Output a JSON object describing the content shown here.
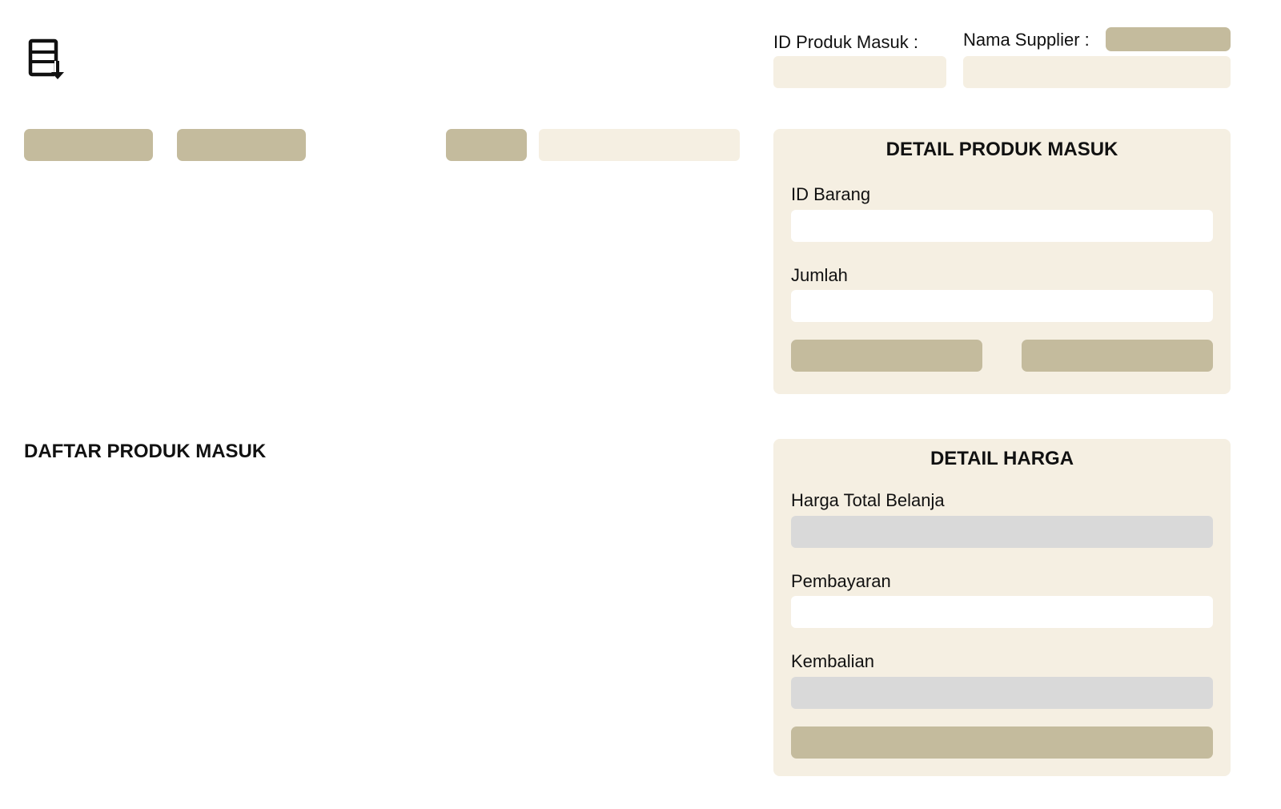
{
  "header": {
    "logo_icon": "document-download-icon",
    "id_produk_masuk_label": "ID Produk Masuk :",
    "id_produk_masuk_value": "",
    "nama_supplier_label": "Nama Supplier :",
    "nama_supplier_value": ""
  },
  "toolbar": {
    "button_1_label": "",
    "button_2_label": "",
    "search_button_label": "",
    "search_value": ""
  },
  "detail_produk_masuk": {
    "title": "DETAIL PRODUK MASUK",
    "id_barang_label": "ID Barang",
    "id_barang_value": "",
    "jumlah_label": "Jumlah",
    "jumlah_value": "",
    "left_button_label": "",
    "right_button_label": ""
  },
  "daftar_produk_masuk": {
    "title": "DAFTAR PRODUK MASUK"
  },
  "detail_harga": {
    "title": "DETAIL HARGA",
    "harga_total_label": "Harga Total Belanja",
    "harga_total_value": "",
    "pembayaran_label": "Pembayaran",
    "pembayaran_value": "",
    "kembalian_label": "Kembalian",
    "kembalian_value": "",
    "submit_button_label": ""
  },
  "colors": {
    "cream": "#f5efe2",
    "khaki": "#c4bb9d",
    "gray_field": "#d9d9d9",
    "text": "#111111"
  }
}
